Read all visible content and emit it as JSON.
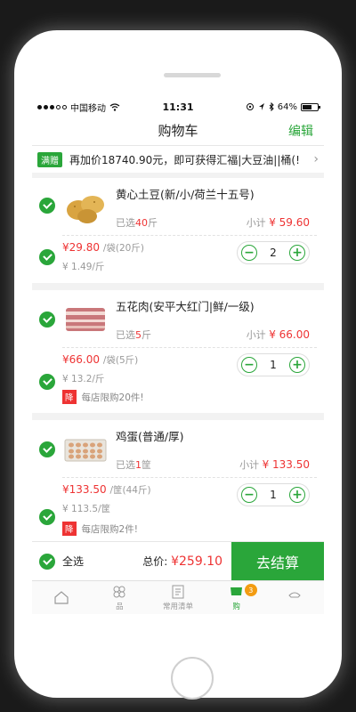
{
  "status": {
    "carrier": "中国移动",
    "time": "11:31",
    "battery": "64%",
    "battery_level": 0.64
  },
  "nav": {
    "title": "购物车",
    "edit_label": "编辑"
  },
  "promo": {
    "badge": "满赠",
    "text": "再加价18740.90元，即可获得汇福|大豆油||桶(!"
  },
  "items": [
    {
      "name": "黄心土豆(新/小/荷兰十五号)",
      "selected_prefix": "已选",
      "selected_qty": "40",
      "selected_unit": "斤",
      "subtotal_label": "小计",
      "subtotal": "¥ 59.60",
      "price": "¥29.80",
      "price_unit": "/袋(20斤)",
      "unit_price": "¥ 1.49/斤",
      "qty": "2",
      "limit_tag": "",
      "limit_text": ""
    },
    {
      "name": "五花肉(安平大红门|鲜/一级)",
      "selected_prefix": "已选",
      "selected_qty": "5",
      "selected_unit": "斤",
      "subtotal_label": "小计",
      "subtotal": "¥ 66.00",
      "price": "¥66.00",
      "price_unit": "/袋(5斤)",
      "unit_price": "¥ 13.2/斤",
      "qty": "1",
      "limit_tag": "降",
      "limit_text": "每店限购20件!"
    },
    {
      "name": "鸡蛋(普通/厚)",
      "selected_prefix": "已选",
      "selected_qty": "1",
      "selected_unit": "筐",
      "subtotal_label": "小计",
      "subtotal": "¥ 133.50",
      "price": "¥133.50",
      "price_unit": "/筐(44斤)",
      "unit_price": "¥ 113.5/筐",
      "qty": "1",
      "limit_tag": "降",
      "limit_text": "每店限购2件!"
    }
  ],
  "stepper": {
    "minus": "−",
    "plus": "+"
  },
  "checkout": {
    "select_all": "全选",
    "total_label": "总价:",
    "total_value": "¥259.10",
    "button": "去结算"
  },
  "tabs": [
    {
      "label": "",
      "icon": "home-icon"
    },
    {
      "label": "品",
      "icon": "category-icon"
    },
    {
      "label": "常用清单",
      "icon": "list-icon"
    },
    {
      "label": "购",
      "icon": "cart-icon",
      "badge": "3",
      "active": true
    },
    {
      "label": "",
      "icon": "profile-icon"
    }
  ],
  "colors": {
    "accent": "#2aa63a",
    "price": "#e33333",
    "badge": "#f39c12"
  }
}
